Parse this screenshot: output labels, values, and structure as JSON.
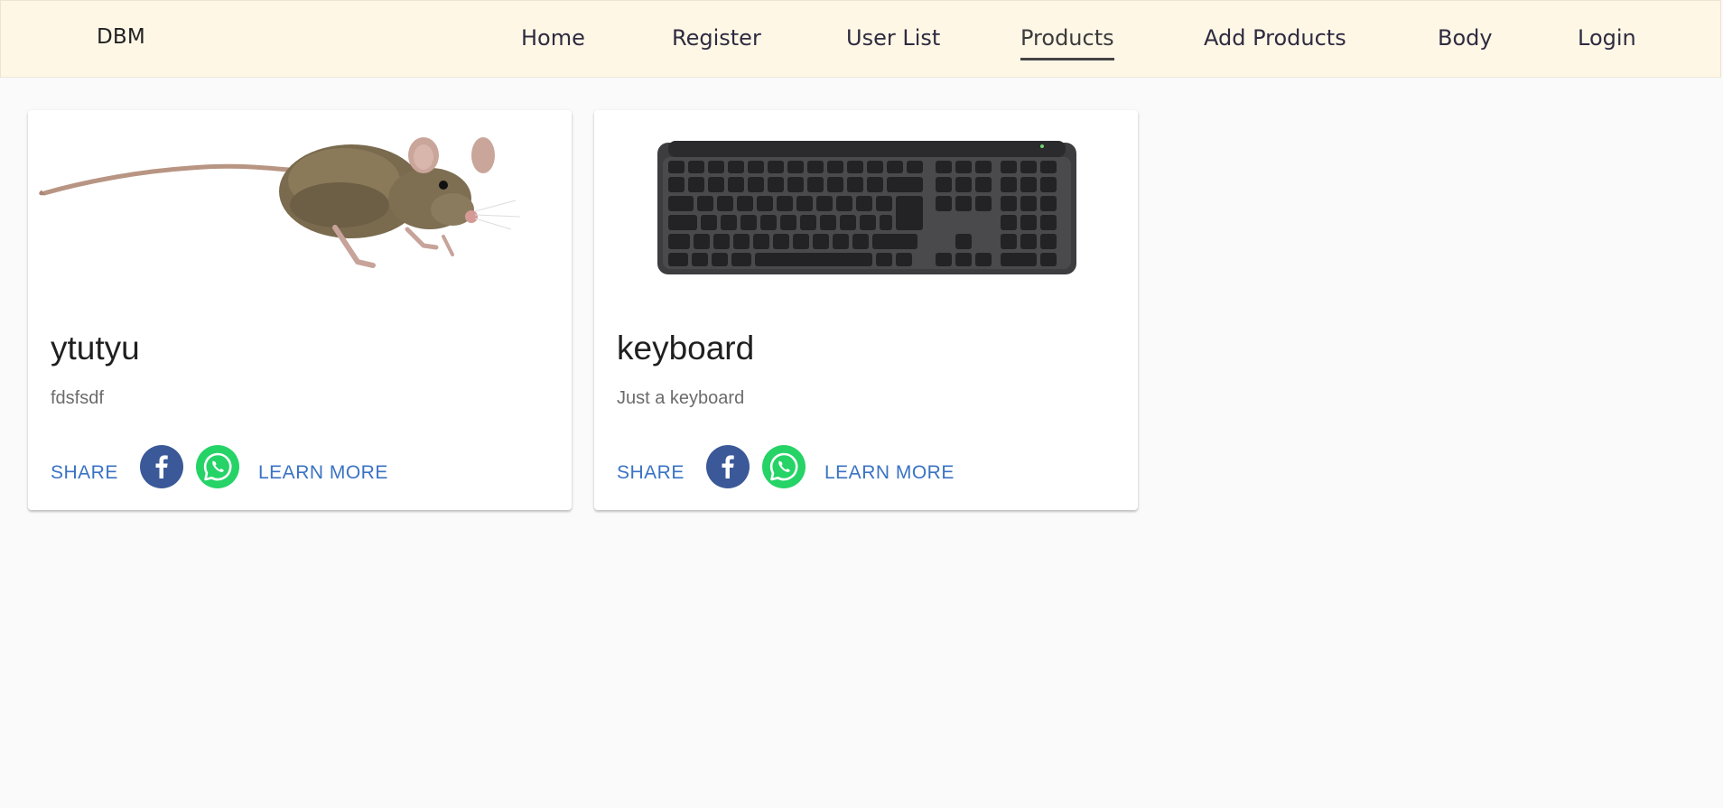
{
  "navbar": {
    "brand": "DBM",
    "links": [
      {
        "label": "Home"
      },
      {
        "label": "Register"
      },
      {
        "label": "User List"
      },
      {
        "label": "Products",
        "active": true
      },
      {
        "label": "Add Products"
      },
      {
        "label": "Body"
      },
      {
        "label": "Login"
      }
    ]
  },
  "products": [
    {
      "title": "ytutyu",
      "description": "fdsfsdf",
      "image": "mouse-animal-image",
      "share_label": "SHARE",
      "learn_more_label": "LEARN MORE",
      "facebook_icon": "facebook-icon",
      "whatsapp_icon": "whatsapp-icon"
    },
    {
      "title": "keyboard",
      "description": "Just a keyboard",
      "image": "keyboard-image",
      "share_label": "SHARE",
      "learn_more_label": "LEARN MORE",
      "facebook_icon": "facebook-icon",
      "whatsapp_icon": "whatsapp-icon"
    }
  ],
  "colors": {
    "navbar_bg": "#fff7e6",
    "page_bg": "#fafafa",
    "link_accent": "#3a73c4",
    "facebook": "#3b5998",
    "whatsapp": "#25d366"
  }
}
